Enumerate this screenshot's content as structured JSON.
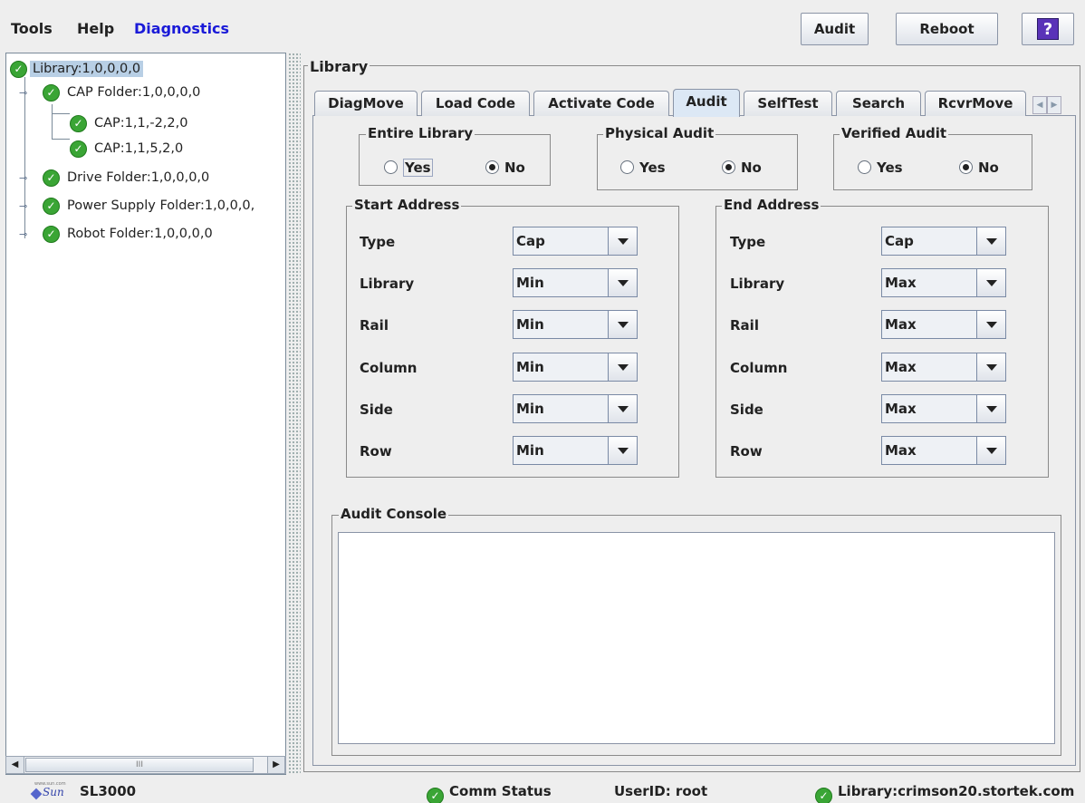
{
  "menu": {
    "tools": "Tools",
    "help": "Help",
    "diagnostics": "Diagnostics"
  },
  "toolbar": {
    "audit_label": "Audit",
    "reboot_label": "Reboot",
    "help_label": "?"
  },
  "tree": {
    "items": [
      {
        "label": "Library:1,0,0,0,0",
        "status": "ok",
        "selected": true
      },
      {
        "label": "CAP Folder:1,0,0,0,0",
        "status": "ok",
        "expanded": true
      },
      {
        "label": "CAP:1,1,-2,2,0",
        "status": "ok"
      },
      {
        "label": "CAP:1,1,5,2,0",
        "status": "ok"
      },
      {
        "label": "Drive Folder:1,0,0,0,0",
        "status": "ok",
        "expanded": false
      },
      {
        "label": "Power Supply Folder:1,0,0,0,",
        "status": "ok",
        "expanded": false
      },
      {
        "label": "Robot Folder:1,0,0,0,0",
        "status": "ok",
        "expanded": false
      }
    ],
    "scroll_grip": "III"
  },
  "panel": {
    "title": "Library",
    "tabs": [
      {
        "label": "DiagMove"
      },
      {
        "label": "Load Code"
      },
      {
        "label": "Activate Code"
      },
      {
        "label": "Audit",
        "active": true
      },
      {
        "label": "SelfTest"
      },
      {
        "label": "Search"
      },
      {
        "label": "RcvrMove"
      }
    ]
  },
  "audit": {
    "entire_library": {
      "title": "Entire Library",
      "yes": "Yes",
      "no": "No",
      "selected": "No"
    },
    "physical_audit": {
      "title": "Physical Audit",
      "yes": "Yes",
      "no": "No",
      "selected": "No"
    },
    "verified_audit": {
      "title": "Verified Audit",
      "yes": "Yes",
      "no": "No",
      "selected": "No"
    },
    "start_address": {
      "title": "Start Address",
      "fields": [
        {
          "label": "Type",
          "value": "Cap"
        },
        {
          "label": "Library",
          "value": "Min"
        },
        {
          "label": "Rail",
          "value": "Min"
        },
        {
          "label": "Column",
          "value": "Min"
        },
        {
          "label": "Side",
          "value": "Min"
        },
        {
          "label": "Row",
          "value": "Min"
        }
      ]
    },
    "end_address": {
      "title": "End Address",
      "fields": [
        {
          "label": "Type",
          "value": "Cap"
        },
        {
          "label": "Library",
          "value": "Max"
        },
        {
          "label": "Rail",
          "value": "Max"
        },
        {
          "label": "Column",
          "value": "Max"
        },
        {
          "label": "Side",
          "value": "Max"
        },
        {
          "label": "Row",
          "value": "Max"
        }
      ]
    },
    "console_title": "Audit Console"
  },
  "status": {
    "logo_small": "www.sun.com",
    "logo_text": "Sun",
    "product": "SL3000",
    "comm": "Comm Status",
    "user": "UserID: root",
    "library": "Library:crimson20.stortek.com"
  },
  "colors": {
    "ok_green": "#3aa535",
    "menu_accent": "#1a1ad8",
    "selection": "#b8cfe5"
  }
}
